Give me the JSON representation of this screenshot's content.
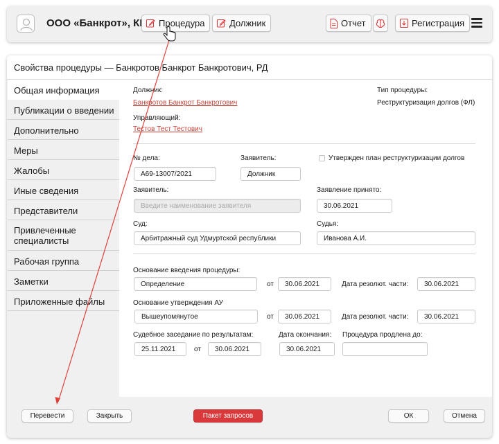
{
  "topbar": {
    "company": "ООО «Банкрот», КП",
    "procedure_label": "Процедура",
    "debtor_label": "Должник",
    "report_label": "Отчет",
    "register_label": "Регистрация"
  },
  "dialog": {
    "title": "Свойства процедуры — Банкротов Банкрот Банкротович, РД"
  },
  "sidebar": {
    "items": [
      {
        "label": "Общая информация"
      },
      {
        "label": "Публикации о введении"
      },
      {
        "label": "Дополнительно"
      },
      {
        "label": "Меры"
      },
      {
        "label": "Жалобы"
      },
      {
        "label": "Иные сведения"
      },
      {
        "label": "Представители"
      },
      {
        "label": "Привлеченные специалисты"
      },
      {
        "label": "Рабочая группа"
      },
      {
        "label": "Заметки"
      },
      {
        "label": "Приложенные файлы"
      }
    ]
  },
  "general": {
    "debtor_label": "Должник:",
    "debtor_value": "Банкротов Банкрот Банкротович",
    "manager_label": "Управляющий:",
    "manager_value": "Тестов Тест Тестович",
    "proc_type_label": "Тип процедуры:",
    "proc_type_value": "Реструктуризация долгов (ФЛ)",
    "case_no_label": "№ дела:",
    "case_no_value": "А69-13007/2021",
    "applicant_type_label": "Заявитель:",
    "applicant_type_value": "Должник",
    "plan_approved_label": "Утвержден план реструктуризации долгов",
    "applicant_label": "Заявитель:",
    "applicant_placeholder": "Введите наименование заявителя",
    "accepted_label": "Заявление принято:",
    "accepted_value": "30.06.2021",
    "court_label": "Суд:",
    "court_value": "Арбитражный суд Удмуртской республики",
    "judge_label": "Судья:",
    "judge_value": "Иванова А.И.",
    "basis_intro_label": "Основание введения процедуры:",
    "basis_intro_value": "Определение",
    "basis_intro_from_label": "от",
    "basis_intro_from_value": "30.06.2021",
    "basis_intro_resol_label": "Дата резолют. части:",
    "basis_intro_resol_value": "30.06.2021",
    "basis_au_label": "Основание утверждения АУ",
    "basis_au_value": "Вышеупомянутое",
    "basis_au_from_label": "от",
    "basis_au_from_value": "30.06.2021",
    "basis_au_resol_label": "Дата резолют. части:",
    "basis_au_resol_value": "30.06.2021",
    "hearing_label": "Судебное заседание по результатам:",
    "hearing_value": "25.11.2021",
    "hearing_from_label": "от",
    "hearing_from_value": "30.06.2021",
    "end_date_label": "Дата окончания:",
    "end_date_value": "30.06.2021",
    "extended_label": "Процедура продлена до:",
    "extended_value": ""
  },
  "footer": {
    "translate_label": "Перевести",
    "close_label": "Закрыть",
    "requests_label": "Пакет запросов",
    "ok_label": "ОК",
    "cancel_label": "Отмена"
  },
  "colors": {
    "accent": "#d9393b",
    "link": "#c8453d",
    "arrow": "#e0403a"
  }
}
